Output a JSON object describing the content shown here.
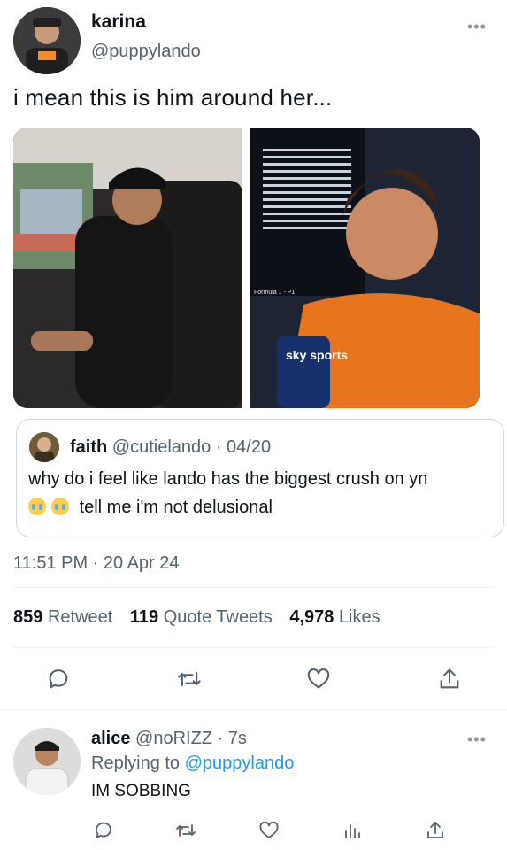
{
  "main_tweet": {
    "name": "karina",
    "handle": "@puppylando",
    "more": "•••",
    "text": "i mean this is him around her...",
    "timestamp": "11:51 PM · 20 Apr 24",
    "photo_right_screen": "Formula 1 - P1",
    "photo_right_logo": "sky sports"
  },
  "quote": {
    "name": "faith",
    "handle": "@cutielando",
    "date": "· 04/20",
    "line1": "why do i feel like lando has the biggest crush on yn",
    "line2": "tell me i'm not delusional"
  },
  "stats": {
    "retweets_count": "859",
    "retweets_label": "Retweet",
    "quotes_count": "119",
    "quotes_label": "Quote Tweets",
    "likes_count": "4,978",
    "likes_label": "Likes"
  },
  "reply": {
    "name": "alice",
    "handle": "@noRIZZ",
    "time": "· 7s",
    "more": "•••",
    "replying_prefix": "Replying to",
    "replying_handle": "@puppylando",
    "text": "IM SOBBING"
  },
  "icons": {
    "reply": "reply-icon",
    "retweet": "retweet-icon",
    "like": "heart-icon",
    "share": "share-icon",
    "views": "views-icon"
  },
  "colors": {
    "text": "#0f1419",
    "muted": "#536471",
    "link": "#1d9bf0",
    "border": "#cfd9de"
  }
}
